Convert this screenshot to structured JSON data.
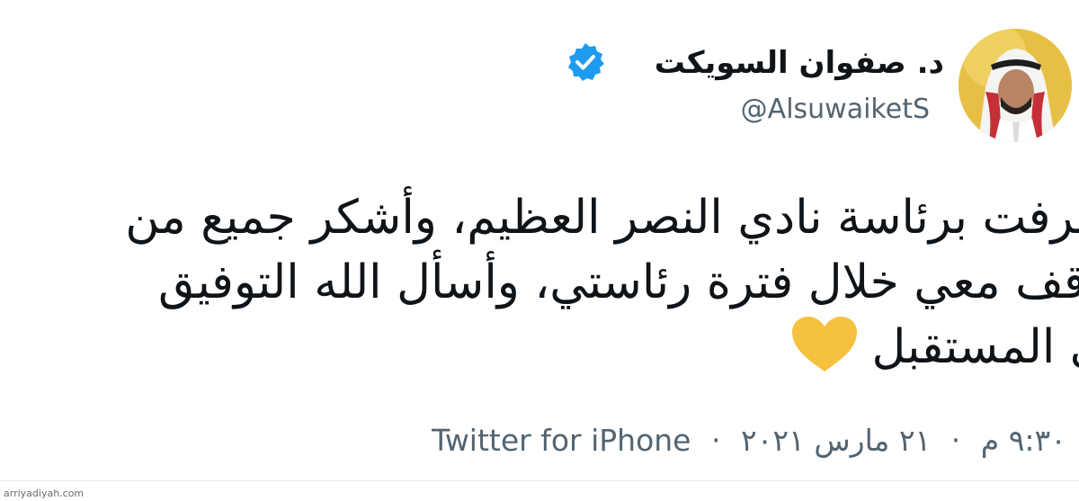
{
  "author": {
    "display_name": "د. صفوان السويكت",
    "handle": "@AlsuwaiketS",
    "verified": true,
    "avatar_icon": "profile-photo"
  },
  "tweet": {
    "lines": [
      "تشرفت برئاسة نادي النصر العظيم، وأشكر جميع من",
      "ووقف معي خلال فترة رئاستي، وأسأل الله التوفيق",
      "في المستقبل"
    ],
    "emoji": "yellow-heart-icon"
  },
  "meta": {
    "time": "٩:٣٠ م",
    "separator": "·",
    "date": "٢١ مارس ٢٠٢١",
    "source": "Twitter for iPhone"
  },
  "watermark": "arriyadiyah.com",
  "colors": {
    "verified_blue": "#1d9bf0",
    "heart_yellow": "#f7c140",
    "secondary_text": "#536471",
    "primary_text": "#0f1419"
  }
}
